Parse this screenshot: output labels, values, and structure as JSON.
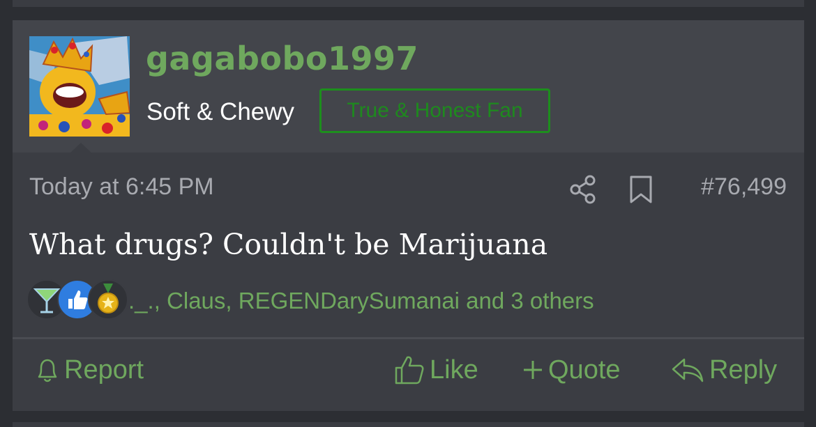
{
  "post": {
    "username": "gagabobo1997",
    "user_title": "Soft & Chewy",
    "user_badge": "True & Honest Fan",
    "timestamp": "Today at 6:45 PM",
    "post_number": "#76,499",
    "message": "What drugs? Couldn't be Marijuana",
    "reactions": {
      "icons": [
        "cocktail-icon",
        "thumbs-up-icon",
        "medal-icon"
      ],
      "summary": "._., Claus, REGENDarySumanai and 3 others"
    },
    "actions": {
      "report": "Report",
      "like": "Like",
      "quote": "Quote",
      "reply": "Reply"
    }
  },
  "colors": {
    "accent_green": "#6fa85e",
    "badge_green": "#1d8f1d",
    "card_bg": "#3b3d43",
    "header_bg": "#43454b"
  }
}
